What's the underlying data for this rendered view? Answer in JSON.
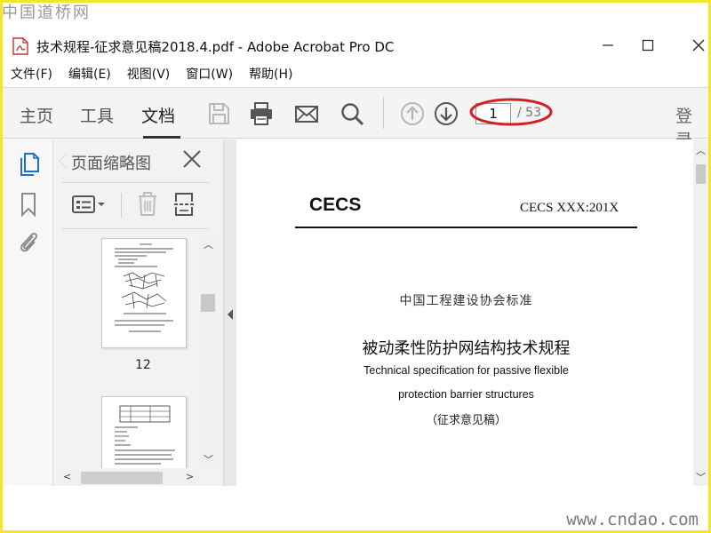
{
  "watermarks": {
    "top_left": "中国道桥网",
    "bottom_right": "www.cndao.com"
  },
  "window": {
    "title": "技术规程-征求意见稿2018.4.pdf - Adobe Acrobat Pro DC",
    "app_icon": "pdf-file-icon",
    "controls": [
      "minimize",
      "maximize",
      "close"
    ]
  },
  "menu": {
    "items": [
      "文件(F)",
      "编辑(E)",
      "视图(V)",
      "窗口(W)",
      "帮助(H)"
    ]
  },
  "toolbar": {
    "tabs": [
      "主页",
      "工具",
      "文档"
    ],
    "active_tab": "文档",
    "icons": [
      "save-icon",
      "print-icon",
      "email-icon",
      "search-icon",
      "page-up-icon",
      "page-down-icon"
    ],
    "page_number": "1",
    "page_total": "/ 53",
    "login_label": "登录",
    "highlight_color": "#d61f1f"
  },
  "rail": {
    "icons": [
      "page-thumbnails-icon",
      "bookmark-icon",
      "attachment-icon"
    ],
    "active": "page-thumbnails-icon",
    "accent": "#1a73c9"
  },
  "panel": {
    "title": "页面缩略图",
    "tools": [
      "page-options-icon",
      "delete-page-icon",
      "extract-pages-icon"
    ],
    "thumbnails": [
      {
        "page_label": "12"
      },
      {
        "page_label": ""
      }
    ]
  },
  "document": {
    "header_left": "CECS",
    "header_right": "CECS XXX:201X",
    "association": "中国工程建设协会标准",
    "title_cn": "被动柔性防护网结构技术规程",
    "title_en_line1": "Technical specification for passive flexible",
    "title_en_line2": "protection barrier structures",
    "draft_note": "（征求意见稿）"
  }
}
